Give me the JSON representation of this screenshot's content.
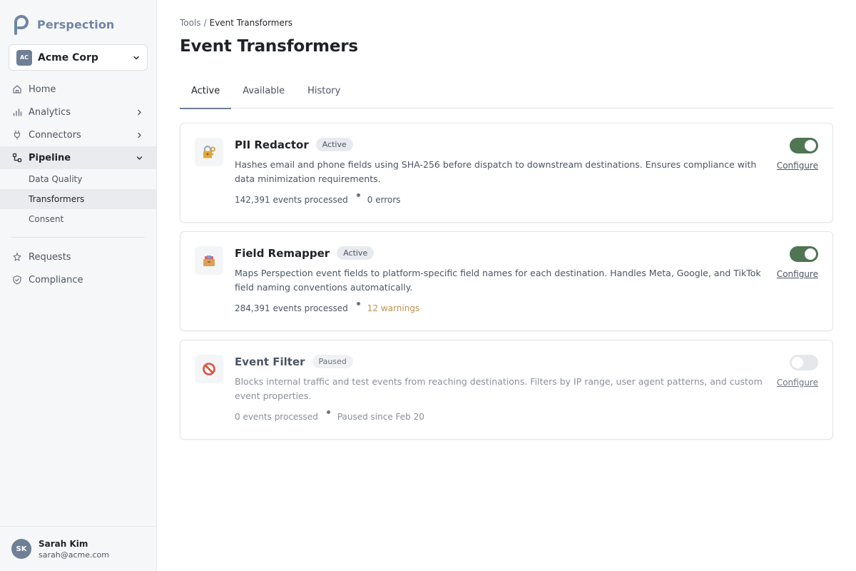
{
  "brand": {
    "name": "Perspection"
  },
  "org": {
    "initials": "AC",
    "name": "Acme Corp"
  },
  "nav": {
    "home": "Home",
    "analytics": "Analytics",
    "connectors": "Connectors",
    "pipeline": "Pipeline",
    "pipeline_sub": [
      "Data Quality",
      "Transformers",
      "Consent"
    ],
    "requests": "Requests",
    "compliance": "Compliance"
  },
  "user": {
    "initials": "SK",
    "name": "Sarah Kim",
    "email": "sarah@acme.com"
  },
  "breadcrumb": {
    "parent": "Tools",
    "separator": "/",
    "current": "Event Transformers"
  },
  "page": {
    "title": "Event Transformers"
  },
  "tabs": [
    "Active",
    "Available",
    "History"
  ],
  "transformers": [
    {
      "icon": "lock-with-key-icon",
      "name": "PII Redactor",
      "status": "Active",
      "enabled": true,
      "description": "Hashes email and phone fields using SHA-256 before dispatch to downstream destinations. Ensures compliance with data minimization requirements.",
      "stat1": "142,391 events processed",
      "stat2": "0 errors",
      "configure": "Configure"
    },
    {
      "icon": "card-index-box-icon",
      "name": "Field Remapper",
      "status": "Active",
      "enabled": true,
      "description": "Maps Perspection event fields to platform-specific field names for each destination. Handles Meta, Google, and TikTok field naming conventions automatically.",
      "stat1": "284,391 events processed",
      "stat2": "12 warnings",
      "configure": "Configure"
    },
    {
      "icon": "prohibited-icon",
      "name": "Event Filter",
      "status": "Paused",
      "enabled": false,
      "description": "Blocks internal traffic and test events from reaching destinations. Filters by IP range, user agent patterns, and custom event properties.",
      "stat1": "0 events processed",
      "stat2": "Paused since Feb 20",
      "configure": "Configure"
    }
  ],
  "colors": {
    "toggle_on": "#4f7552",
    "toggle_off": "#e5e7ea",
    "warning_text": "#c0934e",
    "brand": "#6f86a3"
  }
}
